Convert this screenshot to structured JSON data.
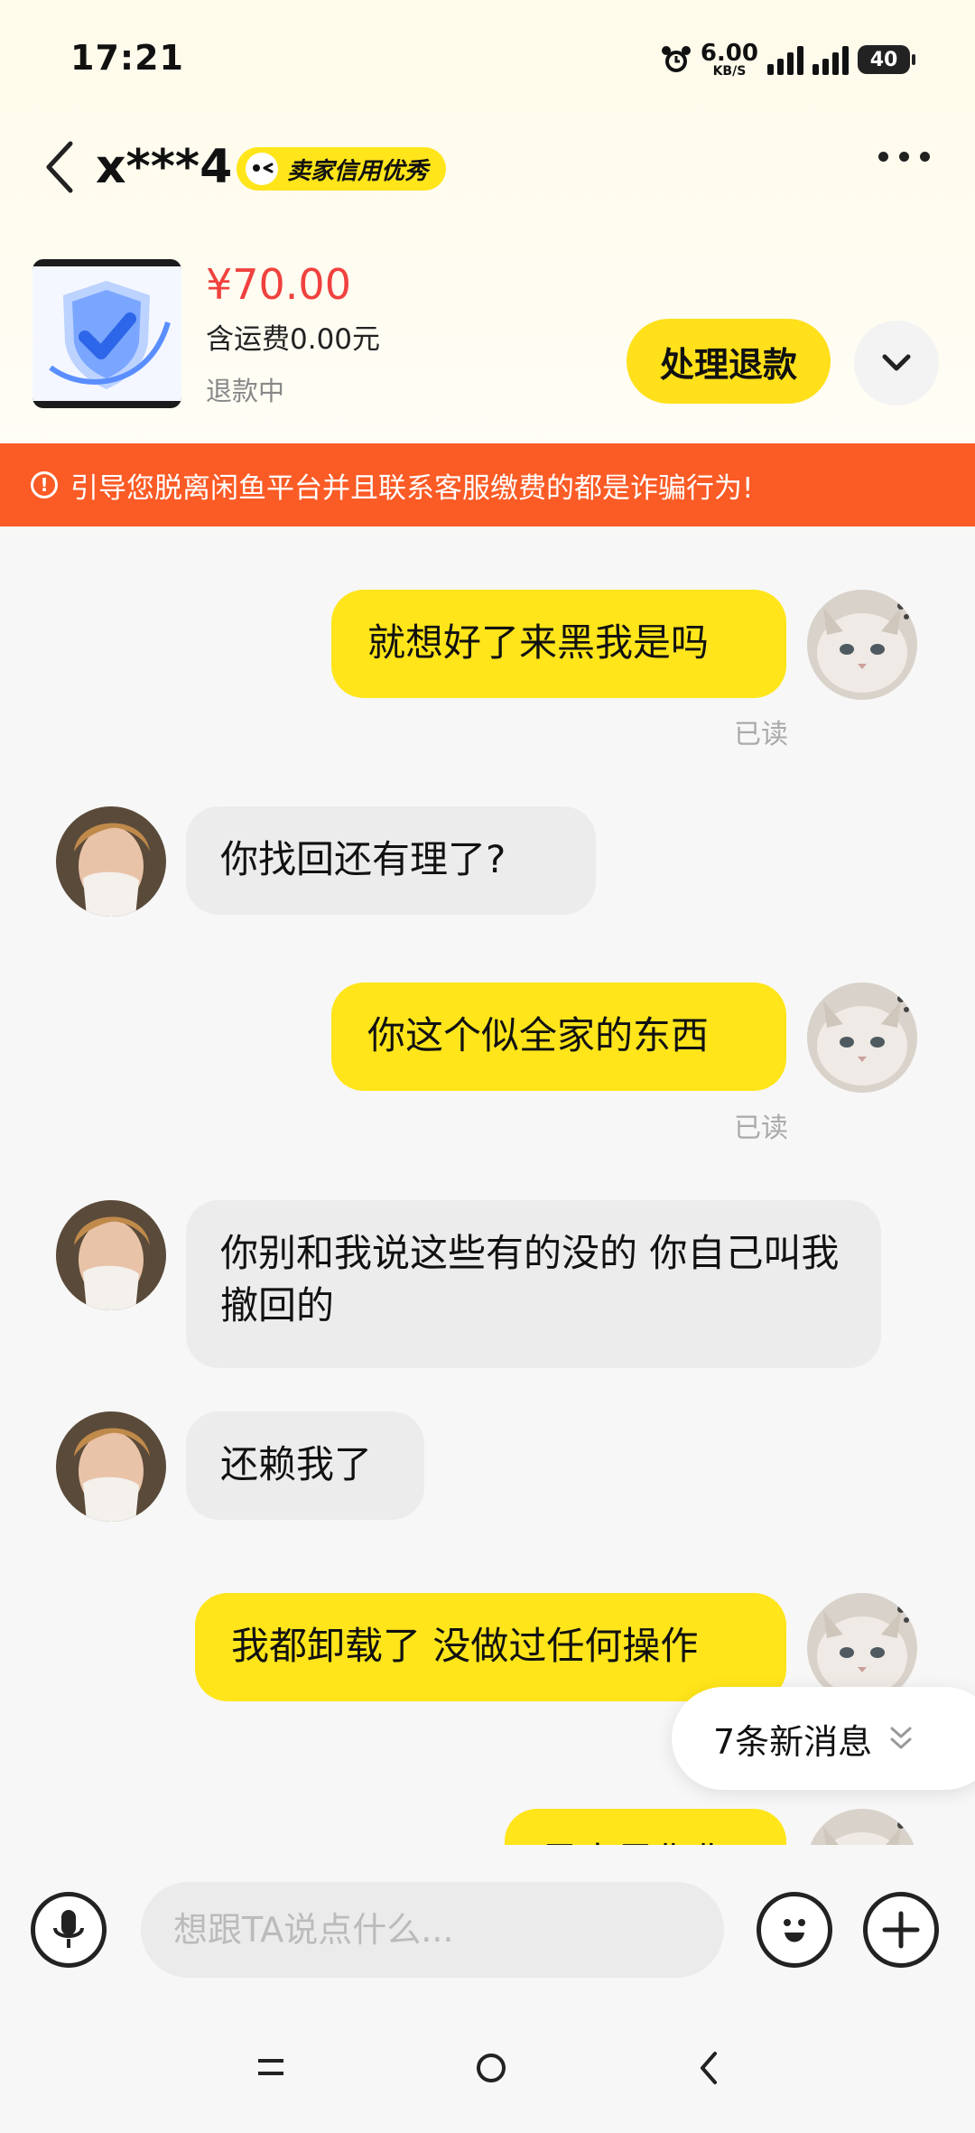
{
  "status_bar": {
    "time": "17:21",
    "net_speed_value": "6.00",
    "net_speed_unit": "KB/S",
    "battery": "40"
  },
  "header": {
    "seller_name": "x***4",
    "credit_badge": "卖家信用优秀"
  },
  "product": {
    "price": "¥70.00",
    "shipping": "含运费0.00元",
    "status": "退款中",
    "refund_button": "处理退款"
  },
  "warning_banner": "引导您脱离闲鱼平台并且联系客服缴费的都是诈骗行为!",
  "messages": [
    {
      "sender": "me",
      "text": "就想好了来黑我是吗",
      "read": "已读"
    },
    {
      "sender": "them",
      "text": "你找回还有理了?"
    },
    {
      "sender": "me",
      "text": "你这个似全家的东西",
      "read": "已读"
    },
    {
      "sender": "them",
      "text": "你别和我说这些有的没的 你自己叫我撤回的"
    },
    {
      "sender": "them",
      "text": "还赖我了"
    },
    {
      "sender": "me",
      "text": "我都卸载了 没做过任何操作"
    },
    {
      "sender": "me",
      "text": "是走是你你"
    }
  ],
  "new_messages_pill": "7条新消息",
  "input": {
    "placeholder": "想跟TA说点什么..."
  }
}
